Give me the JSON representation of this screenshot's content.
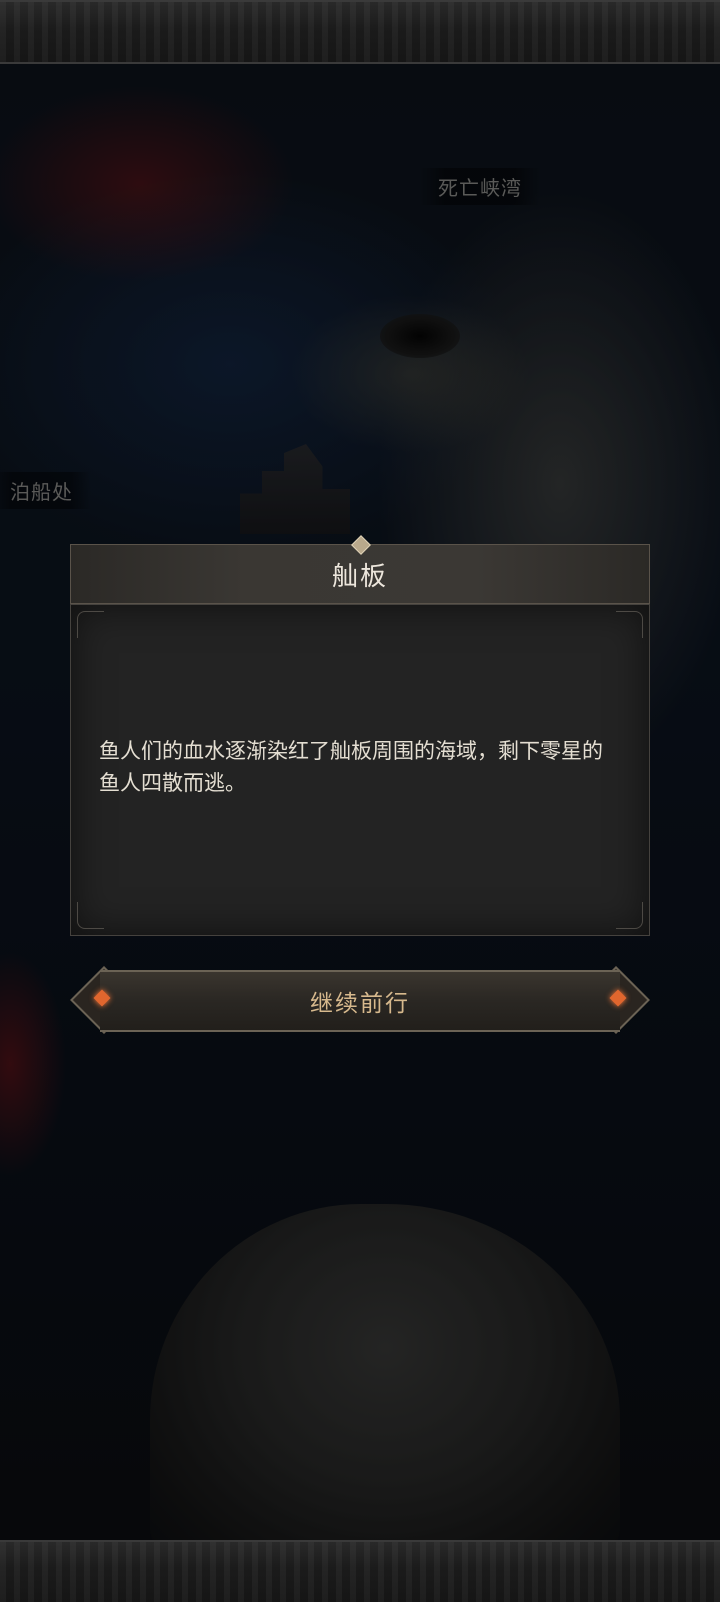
{
  "map": {
    "labels": {
      "canyon_bay": "死亡峡湾",
      "dock": "泊船处"
    }
  },
  "dialog": {
    "title": "舢板",
    "text": "鱼人们的血水逐渐染红了舢板周围的海域，剩下零星的鱼人四散而逃。"
  },
  "actions": {
    "continue_label": "继续前行"
  },
  "colors": {
    "accent_gold": "#d7b98d",
    "gem_orange": "#e0662e",
    "blood_red": "#8c1414"
  }
}
